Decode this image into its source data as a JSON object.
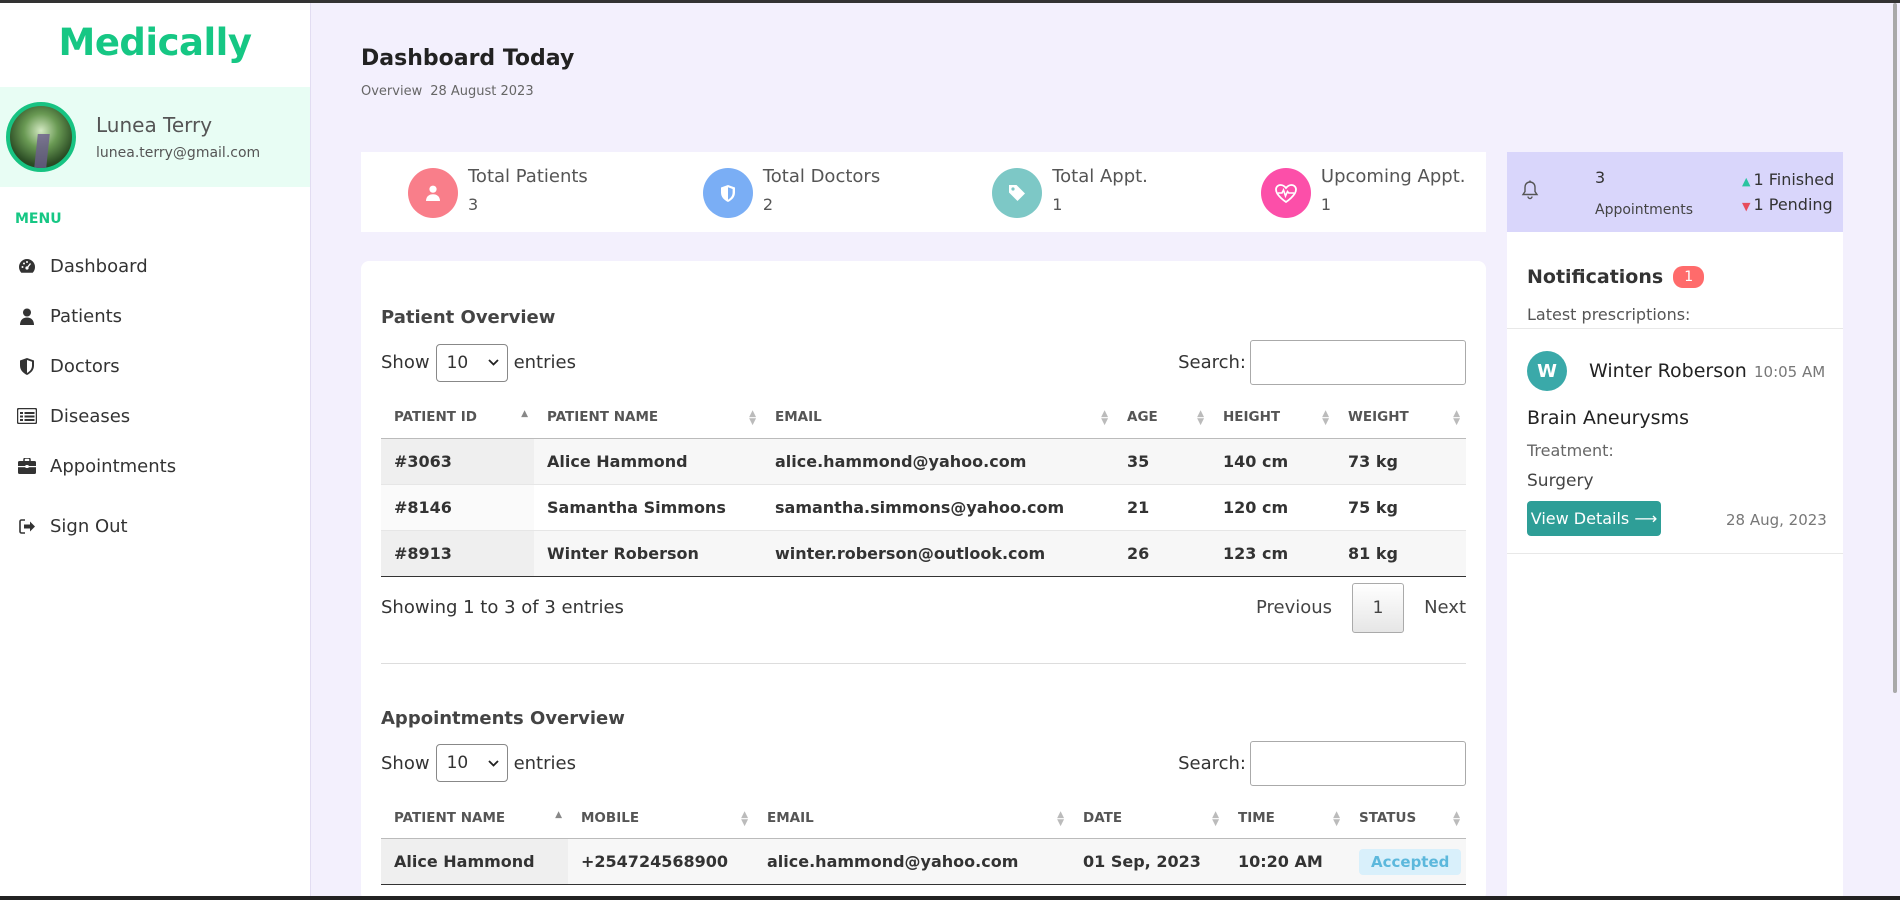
{
  "brand": "Medically",
  "profile": {
    "name": "Lunea Terry",
    "email": "lunea.terry@gmail.com"
  },
  "menu": {
    "label": "MENU",
    "items": [
      {
        "label": "Dashboard",
        "icon": "gauge-icon"
      },
      {
        "label": "Patients",
        "icon": "user-icon"
      },
      {
        "label": "Doctors",
        "icon": "shield-icon"
      },
      {
        "label": "Diseases",
        "icon": "list-icon"
      },
      {
        "label": "Appointments",
        "icon": "briefcase-icon"
      }
    ],
    "signout": "Sign Out"
  },
  "header": {
    "title": "Dashboard Today",
    "breadcrumb": "Overview",
    "date": "28 August 2023"
  },
  "stats": [
    {
      "label": "Total Patients",
      "value": "3",
      "color": "#f97e8a",
      "icon": "user-icon"
    },
    {
      "label": "Total Doctors",
      "value": "2",
      "color": "#7aaef5",
      "icon": "shield-icon"
    },
    {
      "label": "Total Appt.",
      "value": "1",
      "color": "#7dc8c6",
      "icon": "tag-icon"
    },
    {
      "label": "Upcoming Appt.",
      "value": "1",
      "color": "#fc4fa9",
      "icon": "heartbeat-icon"
    }
  ],
  "patients": {
    "title": "Patient Overview",
    "show_label": "Show",
    "entries_label": "entries",
    "page_size": "10",
    "search_label": "Search:",
    "columns": [
      "PATIENT ID",
      "PATIENT NAME",
      "EMAIL",
      "AGE",
      "HEIGHT",
      "WEIGHT"
    ],
    "rows": [
      [
        "#3063",
        "Alice Hammond",
        "alice.hammond@yahoo.com",
        "35",
        "140 cm",
        "73 kg"
      ],
      [
        "#8146",
        "Samantha Simmons",
        "samantha.simmons@yahoo.com",
        "21",
        "120 cm",
        "75 kg"
      ],
      [
        "#8913",
        "Winter Roberson",
        "winter.roberson@outlook.com",
        "26",
        "123 cm",
        "81 kg"
      ]
    ],
    "info": "Showing 1 to 3 of 3 entries",
    "prev": "Previous",
    "page": "1",
    "next": "Next"
  },
  "appointments": {
    "title": "Appointments Overview",
    "show_label": "Show",
    "entries_label": "entries",
    "page_size": "10",
    "search_label": "Search:",
    "columns": [
      "PATIENT NAME",
      "MOBILE",
      "EMAIL",
      "DATE",
      "TIME",
      "STATUS"
    ],
    "rows": [
      [
        "Alice Hammond",
        "+254724568900",
        "alice.hammond@yahoo.com",
        "01 Sep, 2023",
        "10:20 AM",
        "Accepted"
      ]
    ]
  },
  "summary": {
    "count": "3",
    "label": "Appointments",
    "finished": "1 Finished",
    "pending": "1 Pending"
  },
  "notifications": {
    "title": "Notifications",
    "count": "1",
    "latest_label": "Latest prescriptions:",
    "item": {
      "initial": "W",
      "name": "Winter Roberson",
      "time": "10:05 AM",
      "diagnosis": "Brain Aneurysms",
      "treatment_label": "Treatment:",
      "treatment": "Surgery",
      "button": "View Details ⟶",
      "date": "28 Aug, 2023"
    }
  }
}
